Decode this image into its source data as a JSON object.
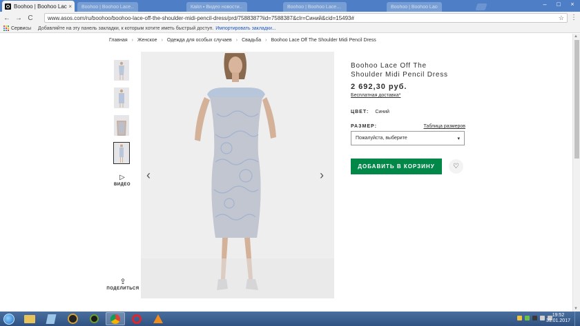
{
  "browser": {
    "tab_title": "Boohoo | Boohoo Lace C",
    "tab_close": "×",
    "other_tabs": [
      "Boohoo | Boohoo Lace…",
      "Кайл ▪ Видео новости…",
      "Boohoo | Boohoo Lace…",
      "Boohoo | Boohoo Lace…"
    ],
    "window_controls": [
      "–",
      "□",
      "×"
    ],
    "nav": {
      "back": "←",
      "forward": "→",
      "reload": "C"
    },
    "url": "www.asos.com/ru/boohoo/boohoo-lace-off-the-shoulder-midi-pencil-dress/prd/7588387?iid=7588387&clr=Синий&cid=15493#",
    "bookmarks_bar": {
      "apps_label": "Сервисы",
      "prompt": "Добавляйте на эту панель закладки, к которым хотите иметь быстрый доступ.",
      "import_link": "Импортировать закладки..."
    }
  },
  "breadcrumb": [
    "Главная",
    "Женское",
    "Одежда для особых случаев",
    "Свадьба",
    "Boohoo Lace Off The Shoulder Midi Pencil Dress"
  ],
  "gallery": {
    "thumbnails": 4,
    "active_index": 3,
    "video_label": "ВИДЕО",
    "share_label": "ПОДЕЛИТЬСЯ",
    "prev_arrow": "‹",
    "next_arrow": "›"
  },
  "product": {
    "name_line1": "Boohoo Lace Off The",
    "name_line2": "Shoulder Midi Pencil Dress",
    "price": "2 692,30 руб.",
    "delivery": "Бесплатная доставка*",
    "color_label": "ЦВЕТ:",
    "color_value": "Синий",
    "size_label": "РАЗМЕР:",
    "size_chart_link": "Таблица размеров",
    "size_select": "Пожалуйста, выберите",
    "add_to_bag": "ДОБАВИТЬ В КОРЗИНУ"
  },
  "taskbar": {
    "time": "19:52",
    "date": "31.01.2017"
  },
  "colors": {
    "accent_green": "#018849",
    "chrome_blue": "#4e7fc6",
    "dress_blue": "#b9c7dd"
  }
}
